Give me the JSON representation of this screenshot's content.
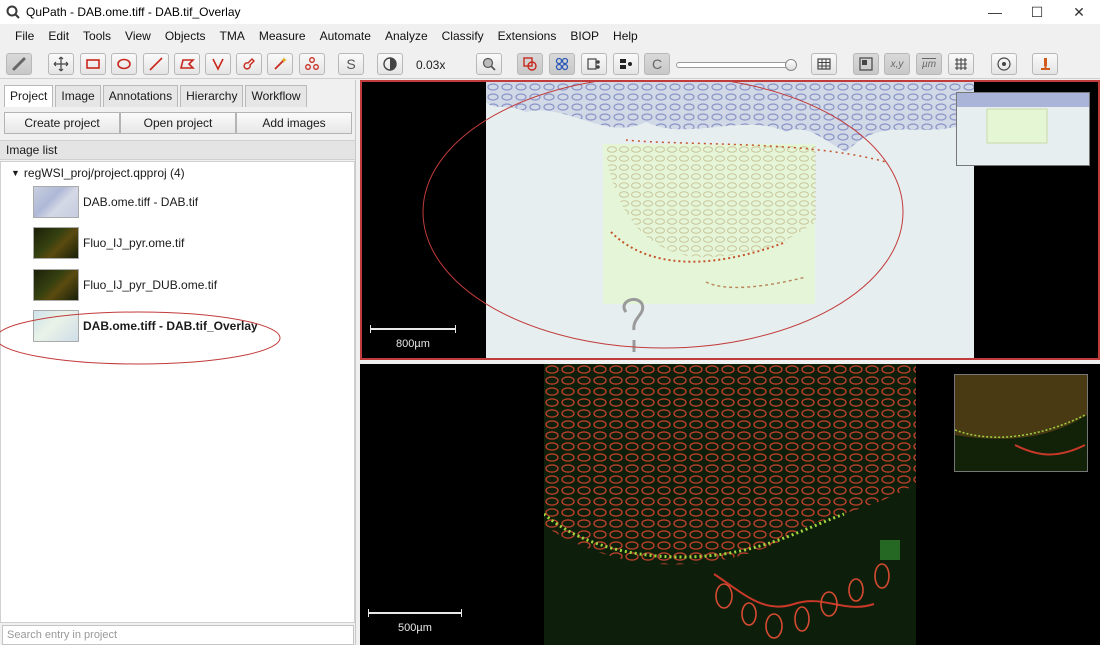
{
  "window": {
    "title": "QuPath - DAB.ome.tiff - DAB.tif_Overlay",
    "controls": [
      "—",
      "☐",
      "✕"
    ]
  },
  "menu": [
    "File",
    "Edit",
    "Tools",
    "View",
    "Objects",
    "TMA",
    "Measure",
    "Automate",
    "Analyze",
    "Classify",
    "Extensions",
    "BIOP",
    "Help"
  ],
  "toolbar": {
    "zoom_value": "0.03x",
    "script_label": "S",
    "brush_label": "C",
    "xy_label": "x,y",
    "um_label": "µm"
  },
  "left_panel": {
    "tabs": [
      "Project",
      "Image",
      "Annotations",
      "Hierarchy",
      "Workflow"
    ],
    "buttons": {
      "create": "Create project",
      "open": "Open project",
      "add": "Add images"
    },
    "list_header": "Image list",
    "project_root": "regWSI_proj/project.qpproj (4)",
    "images": [
      {
        "name": "DAB.ome.tiff - DAB.tif",
        "thumb": "dab"
      },
      {
        "name": "Fluo_IJ_pyr.ome.tif",
        "thumb": "fluo"
      },
      {
        "name": "Fluo_IJ_pyr_DUB.ome.tif",
        "thumb": "fluo"
      },
      {
        "name": "DAB.ome.tiff - DAB.tif_Overlay",
        "thumb": "overlay"
      }
    ],
    "search_placeholder": "Search entry in project"
  },
  "viewers": {
    "top_scale": "800µm",
    "bottom_scale": "500µm"
  },
  "colors": {
    "annotation_red": "#c23b3b",
    "tissue_blue": "#6b78b4",
    "fluo_red": "#c8392a",
    "fluo_green": "#8fd23a"
  }
}
